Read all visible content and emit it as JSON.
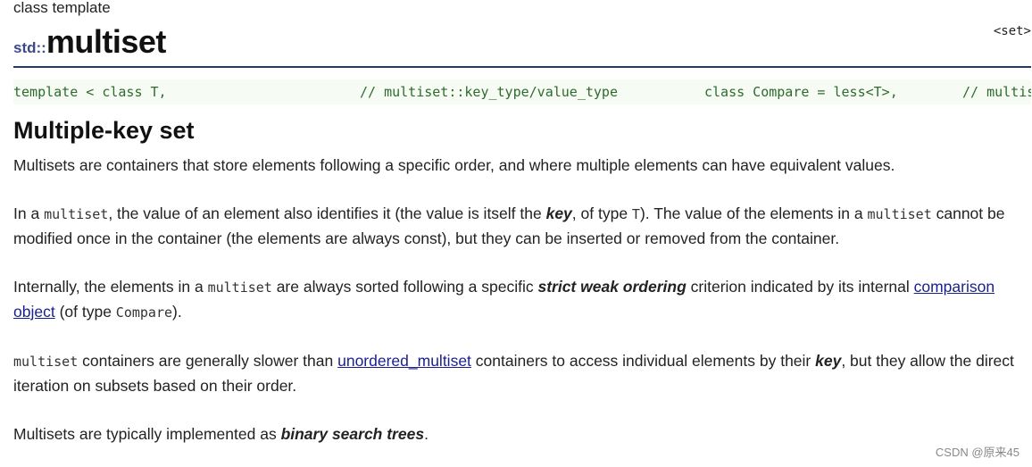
{
  "header": {
    "kind": "class template",
    "namespace": "std::",
    "name": "multiset",
    "header_link": "<set>"
  },
  "code_strip": {
    "col1": "template < class T,",
    "col2": "// multiset::key_type/value_type",
    "col3": "class Compare = less<T>,",
    "col4": "// multiset::key_compare"
  },
  "section_title": "Multiple-key set",
  "p1": "Multisets are containers that store elements following a specific order, and where multiple elements can have equivalent values.",
  "p2": {
    "t1": "In a ",
    "code1": "multiset",
    "t2": ", the value of an element also identifies it (the value is itself the ",
    "key": "key",
    "t3": ", of type ",
    "code2": "T",
    "t4": "). The value of the elements in a ",
    "code3": "multiset",
    "t5": " cannot be modified once in the container (the elements are always const), but they can be inserted or removed from the container."
  },
  "p3": {
    "t1": "Internally, the elements in a ",
    "code1": "multiset",
    "t2": " are always sorted following a specific ",
    "swo": "strict weak ordering",
    "t3": " criterion indicated by its internal ",
    "link": "comparison object",
    "t4": " (of type ",
    "code2": "Compare",
    "t5": ")."
  },
  "p4": {
    "code1": "multiset",
    "t1": " containers are generally slower than ",
    "link": "unordered_multiset",
    "t2": " containers to access individual elements by their ",
    "key": "key",
    "t3": ", but they allow the direct iteration on subsets based on their order."
  },
  "p5": {
    "t1": "Multisets are typically implemented as ",
    "bst": "binary search trees",
    "t2": "."
  },
  "watermark": "CSDN @原来45"
}
